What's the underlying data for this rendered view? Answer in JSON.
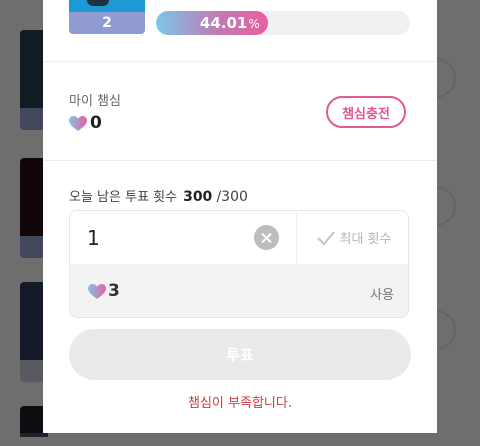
{
  "top_card": {
    "rank": "2"
  },
  "progress": {
    "value_text": "44.01",
    "unit": "%",
    "fraction": 0.4401
  },
  "my_hearts": {
    "label": "마이 챔심",
    "value": "0",
    "charge_button": "챔심충전"
  },
  "votes": {
    "label": "오늘 남은 투표 횟수",
    "remaining": "300",
    "total": "/300"
  },
  "count_input": {
    "value": "1"
  },
  "max_button": {
    "label": "최대 횟수"
  },
  "use_row": {
    "value": "3",
    "label": "사용"
  },
  "vote_button": {
    "label": "투표"
  },
  "error": {
    "message": "챔심이 부족합니다."
  },
  "colors": {
    "accent": "#e05a94",
    "error": "#cf3b3b",
    "disabled_button": "#eaeaea"
  },
  "icons": {
    "heart": "heart-gradient-icon",
    "clear": "clear-circle-icon",
    "check": "check-icon"
  }
}
